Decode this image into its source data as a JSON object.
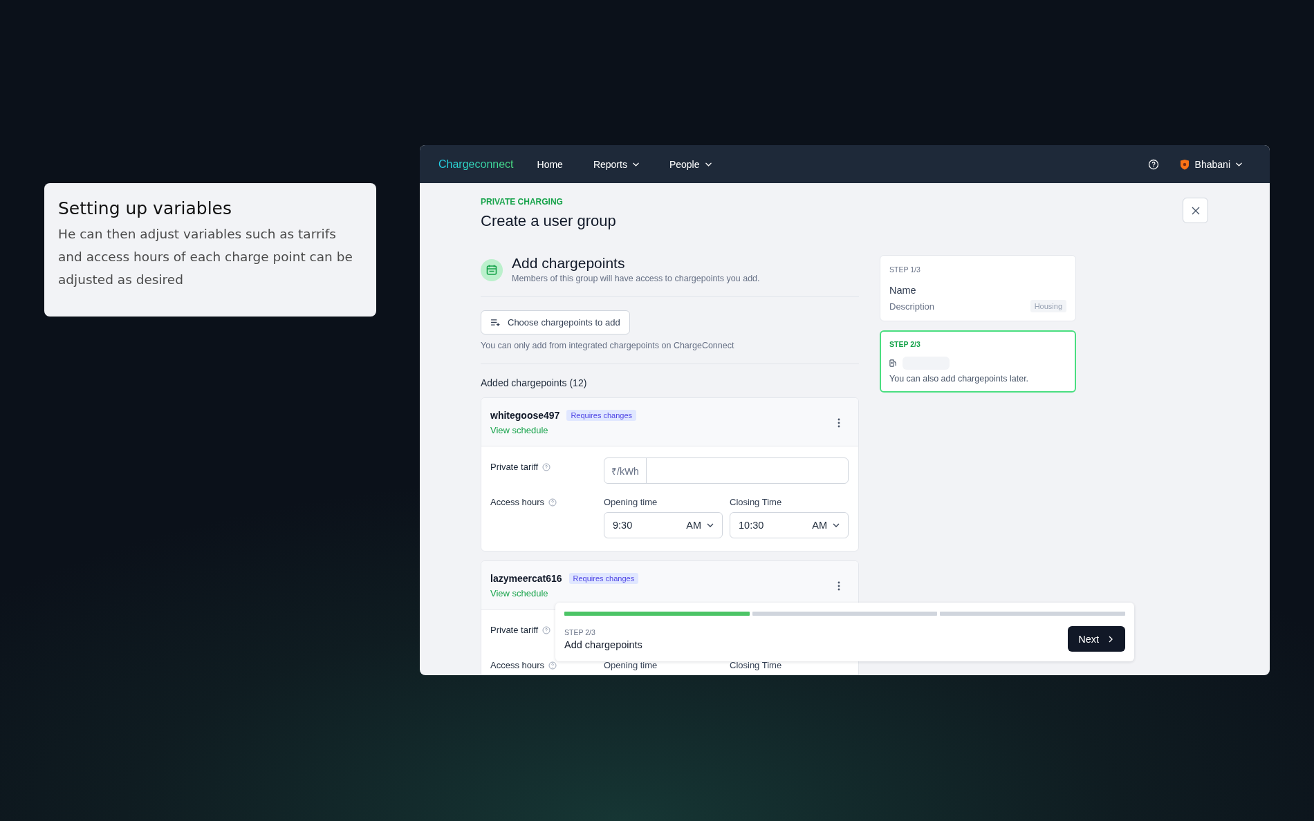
{
  "annotation": {
    "title": "Setting up variables",
    "body": "He can then adjust variables such as tarrifs and access hours of each charge point can be adjusted as desired"
  },
  "nav": {
    "brand": "Chargeconnect",
    "items": [
      {
        "label": "Home",
        "dropdown": false
      },
      {
        "label": "Reports",
        "dropdown": true
      },
      {
        "label": "People",
        "dropdown": true
      }
    ],
    "user": "Bhabani"
  },
  "header": {
    "eyebrow": "PRIVATE CHARGING",
    "title": "Create a user group"
  },
  "section": {
    "title": "Add chargepoints",
    "subtitle": "Members of this group will have access to chargepoints you add."
  },
  "choose_button": "Choose chargepoints to add",
  "note": "You can only add from integrated chargepoints on ChargeConnect",
  "added_title": "Added chargepoints (12)",
  "chargepoints": [
    {
      "name": "whitegoose497",
      "badge": "Requires changes",
      "link": "View schedule",
      "tariff_label": "Private tariff",
      "tariff_unit": "₹/kWh",
      "hours_label": "Access hours",
      "opening_label": "Opening time",
      "opening_time": "9:30",
      "opening_period": "AM",
      "closing_label": "Closing Time",
      "closing_time": "10:30",
      "closing_period": "AM"
    },
    {
      "name": "lazymeercat616",
      "badge": "Requires changes",
      "link": "View schedule",
      "tariff_label": "Private tariff",
      "hours_label": "Access hours",
      "opening_label": "Opening time",
      "closing_label": "Closing Time"
    }
  ],
  "steps": [
    {
      "step": "STEP 1/3",
      "selected": false,
      "title": "Name",
      "description": "Description",
      "tag": "Housing"
    },
    {
      "step": "STEP 2/3",
      "selected": true,
      "note": "You can also add chargepoints later."
    }
  ],
  "footer": {
    "segments": [
      {
        "done": true
      },
      {
        "done": false
      },
      {
        "done": false
      }
    ],
    "step": "STEP 2/3",
    "title": "Add chargepoints",
    "next": "Next"
  }
}
